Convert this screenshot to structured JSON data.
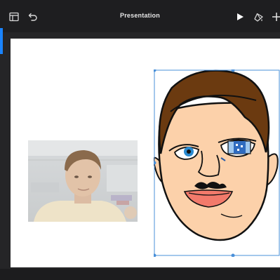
{
  "app": {
    "title": "Presentation"
  },
  "toolbar": {
    "left_icons": [
      "layout-icon",
      "undo-icon"
    ],
    "right_icons": [
      "play-icon",
      "format-brush-icon",
      "add-icon"
    ]
  },
  "colors": {
    "accent": "#1a84ff",
    "selection": "#4a90d9",
    "slide_background": "#ffffff",
    "toolbar_background": "#1e1e20"
  },
  "slide": {
    "elements": [
      "photo-image",
      "drawn-face-image"
    ],
    "selected": "drawn-face-image"
  }
}
